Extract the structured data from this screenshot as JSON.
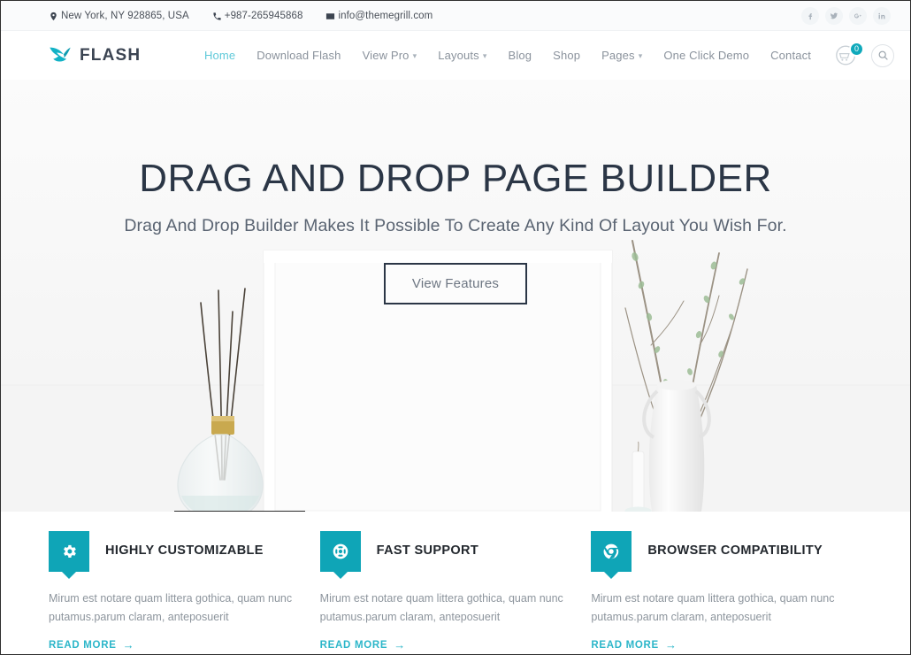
{
  "topbar": {
    "address": "New York, NY 928865, USA",
    "phone": "+987-265945868",
    "email": "info@themegrill.com",
    "socials": [
      {
        "name": "facebook",
        "label": "f"
      },
      {
        "name": "twitter",
        "label": "t"
      },
      {
        "name": "google-plus",
        "label": "G+"
      },
      {
        "name": "linkedin",
        "label": "in"
      }
    ]
  },
  "header": {
    "logo_text": "FLASH",
    "nav": [
      {
        "label": "Home",
        "active": true,
        "dropdown": false
      },
      {
        "label": "Download Flash",
        "active": false,
        "dropdown": false
      },
      {
        "label": "View Pro",
        "active": false,
        "dropdown": true
      },
      {
        "label": "Layouts",
        "active": false,
        "dropdown": true
      },
      {
        "label": "Blog",
        "active": false,
        "dropdown": false
      },
      {
        "label": "Shop",
        "active": false,
        "dropdown": false
      },
      {
        "label": "Pages",
        "active": false,
        "dropdown": true
      },
      {
        "label": "One Click Demo",
        "active": false,
        "dropdown": false
      },
      {
        "label": "Contact",
        "active": false,
        "dropdown": false
      }
    ],
    "cart_count": "0"
  },
  "hero": {
    "title": "DRAG AND DROP PAGE BUILDER",
    "subtitle": "Drag And Drop Builder Makes It Possible To Create Any Kind Of Layout You Wish For.",
    "button_label": "View Features"
  },
  "features": [
    {
      "icon": "gear-icon",
      "title": "HIGHLY CUSTOMIZABLE",
      "description": "Mirum est notare quam littera gothica, quam nunc putamus.parum claram, anteposuerit",
      "link_label": "READ MORE",
      "link_arrow": "→"
    },
    {
      "icon": "lifebuoy-icon",
      "title": "FAST SUPPORT",
      "description": "Mirum est notare quam littera gothica, quam nunc putamus.parum claram, anteposuerit",
      "link_label": "READ MORE",
      "link_arrow": "→"
    },
    {
      "icon": "browser-chrome-icon",
      "title": "BROWSER COMPATIBILITY",
      "description": "Mirum est notare quam littera gothica, quam nunc putamus.parum claram, anteposuerit",
      "link_label": "READ MORE",
      "link_arrow": "→"
    }
  ],
  "colors": {
    "accent_teal": "#0fa5b7",
    "accent_light": "#5fc9d9",
    "heading_dark": "#2b3646",
    "muted_text": "#8d959d",
    "topbar_bg": "#fafbfc"
  }
}
